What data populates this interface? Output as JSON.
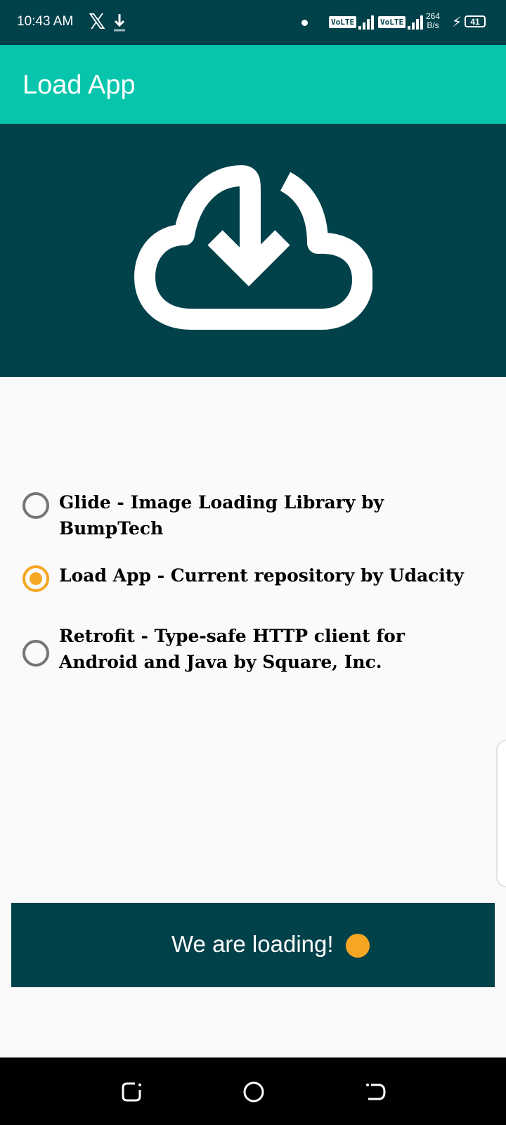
{
  "status_bar": {
    "time": "10:43 AM",
    "x_glyph": "𝕏",
    "volte_1": "VoLTE",
    "volte_2": "VoLTE",
    "net_speed_value": "264",
    "net_speed_unit": "B/s",
    "battery": "41",
    "icons": [
      "x-app-icon",
      "download-icon",
      "notification-dot-icon",
      "signal-icon",
      "charging-icon",
      "battery-icon"
    ]
  },
  "app_bar": {
    "title": "Load App"
  },
  "header": {
    "icon": "cloud-download-icon"
  },
  "options": [
    {
      "label": "Glide - Image Loading Library by BumpTech",
      "checked": false
    },
    {
      "label": "Load App - Current repository by Udacity",
      "checked": true
    },
    {
      "label": "Retrofit - Type-safe HTTP client for Android and Java by Square, Inc.",
      "checked": false
    }
  ],
  "loading_button": {
    "label": "We are loading!",
    "progress_color": "#f5a623"
  },
  "nav_bar": {
    "icons": [
      "recents-icon",
      "home-icon",
      "back-icon"
    ]
  },
  "colors": {
    "primary": "#07c5ac",
    "primary_dark": "#00414a",
    "accent": "#f5a623",
    "background": "#fafafa"
  }
}
